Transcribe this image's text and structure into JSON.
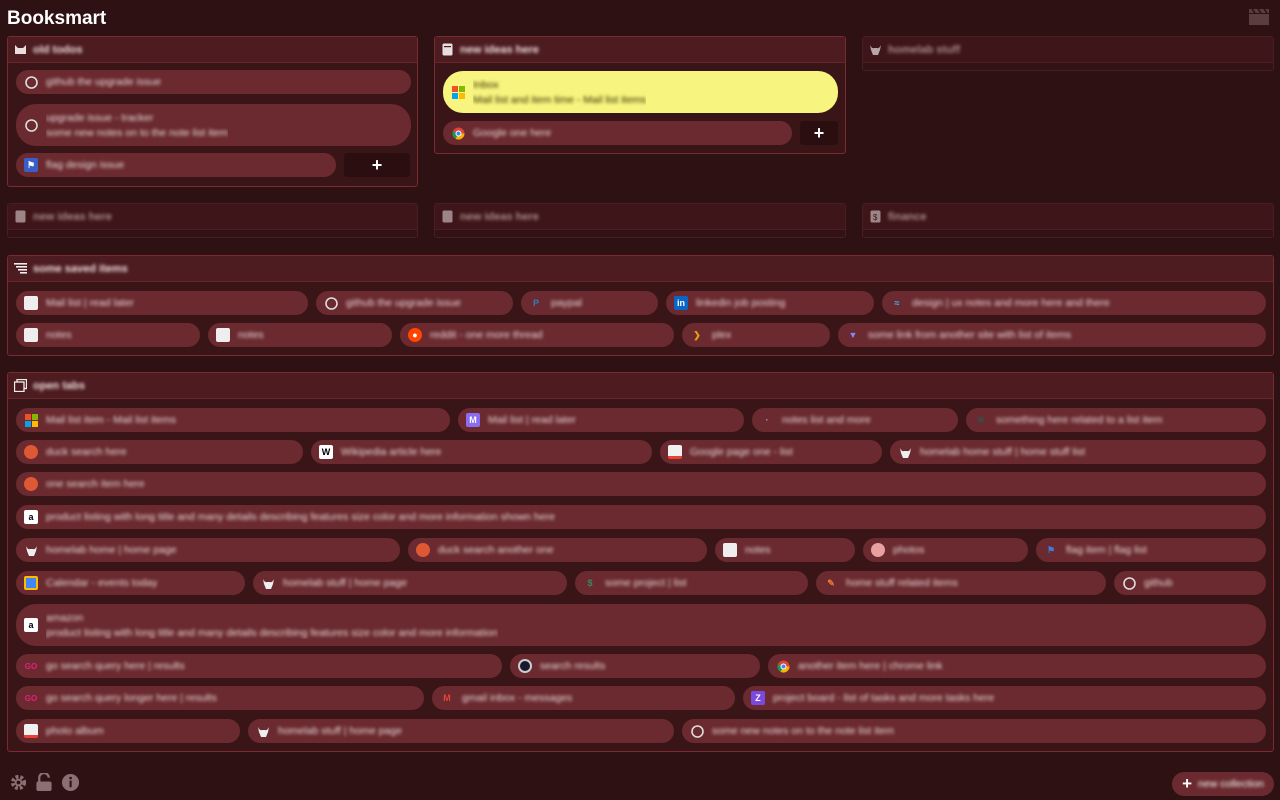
{
  "app": {
    "title": "Booksmart"
  },
  "panels": [
    {
      "title": "old todos",
      "icon": "cat-icon",
      "items": [
        {
          "text": "github the upgrade issue",
          "fav": "github"
        },
        {
          "text": "upgrade issue - tracker",
          "sub": "some new notes on to the note list item",
          "fav": "github",
          "tall": true
        },
        {
          "text": "flag design issue",
          "fav": "flag"
        }
      ],
      "add": "+"
    },
    {
      "title": "new ideas here",
      "icon": "note-icon",
      "items": [
        {
          "text": "Inbox",
          "sub": "Mail list and item time - Mail list items",
          "fav": "microsoft",
          "tall": true,
          "highlight": true
        },
        {
          "text": "Google one here",
          "fav": "chrome"
        }
      ],
      "add": "+"
    },
    {
      "title": "homelab stuff",
      "icon": "bull-icon",
      "items": []
    },
    {
      "title": "new ideas here",
      "icon": "note-icon",
      "items": []
    },
    {
      "title": "new ideas here",
      "icon": "note-icon",
      "items": []
    },
    {
      "title": "finance",
      "icon": "dollar-icon",
      "items": []
    },
    {
      "title": "some saved items",
      "icon": "filter-icon",
      "items": [
        {
          "text": "Mail list | read later",
          "fav": "page"
        },
        {
          "text": "github the upgrade issue",
          "fav": "github"
        },
        {
          "text": "paypal",
          "fav": "paypal"
        },
        {
          "text": "linkedin job posting",
          "fav": "linkedin"
        },
        {
          "text": "design | ux notes and more here and there",
          "fav": "tailwind"
        },
        {
          "text": "notes",
          "fav": "page"
        },
        {
          "text": "notes",
          "fav": "page"
        },
        {
          "text": "reddit - one more thread",
          "fav": "reddit"
        },
        {
          "text": "plex",
          "fav": "plex"
        },
        {
          "text": "some link from another site with list of items",
          "fav": "vercel"
        }
      ]
    },
    {
      "title": "open tabs",
      "icon": "tabs-icon",
      "items": [
        {
          "text": "Mail list item - Mail list items",
          "fav": "microsoft"
        },
        {
          "text": "Mail list | read later",
          "fav": "proton"
        },
        {
          "text": "notes list and more",
          "fav": "dot"
        },
        {
          "text": "something here related to a list item",
          "fav": "gear"
        },
        {
          "text": "duck search here",
          "fav": "duckduckgo"
        },
        {
          "text": "Wikipedia article here",
          "fav": "wiki"
        },
        {
          "text": "Google page one - list",
          "fav": "gdrive"
        },
        {
          "text": "homelab home stuff | home stuff list",
          "fav": "bull"
        },
        {
          "text": "one search item here",
          "fav": "duckduckgo"
        },
        {
          "text": "product listing with long title and many details describing features size color and more information shown here",
          "fav": "amazon"
        },
        {
          "text": "homelab home | home page",
          "fav": "bull"
        },
        {
          "text": "duck search another one",
          "fav": "duckduckgo"
        },
        {
          "text": "notes",
          "fav": "page"
        },
        {
          "text": "photos",
          "fav": "photos"
        },
        {
          "text": "flag item | flag list",
          "fav": "flag"
        },
        {
          "text": "Calendar - events today",
          "fav": "calendar"
        },
        {
          "text": "homelab stuff | home page",
          "fav": "bull"
        },
        {
          "text": "some project | list",
          "fav": "shell"
        },
        {
          "text": "home stuff related items",
          "fav": "tool"
        },
        {
          "text": "github",
          "fav": "github"
        },
        {
          "text": "amazon",
          "sub": "product listing with long title and many details describing features size color and more information",
          "fav": "amazon",
          "tall": true
        },
        {
          "text": "go search query here | results",
          "fav": "go"
        },
        {
          "text": "search results",
          "fav": "circle"
        },
        {
          "text": "another item here | chrome link",
          "fav": "chrome"
        },
        {
          "text": "go search query longer here | results",
          "fav": "go"
        },
        {
          "text": "gmail inbox - messages",
          "fav": "gmail"
        },
        {
          "text": "project board - list of tasks and more tasks here",
          "fav": "z"
        },
        {
          "text": "photo album",
          "fav": "gdrive"
        },
        {
          "text": "homelab stuff | home page",
          "fav": "bull"
        },
        {
          "text": "some new notes on to the note list item",
          "fav": "github"
        }
      ]
    }
  ],
  "footer": {
    "new_group_label": "new collection"
  },
  "colors": {
    "background": "#2e1113",
    "panel": "#3a1518",
    "pill": "#6a2a2f",
    "highlight": "#f7f57f",
    "accent_border": "#7a2a30"
  }
}
